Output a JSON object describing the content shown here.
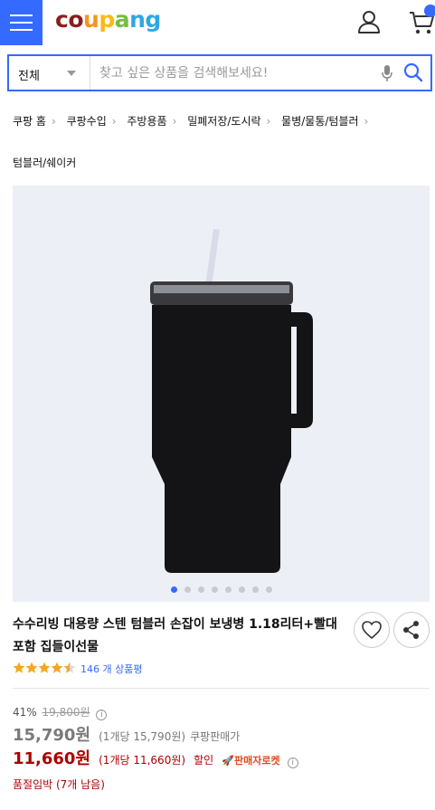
{
  "header": {
    "logo": [
      "c",
      "o",
      "u",
      "p",
      "a",
      "n",
      "g"
    ],
    "menu_icon": "hamburger-icon",
    "user_icon": "user-icon",
    "cart_icon": "cart-icon"
  },
  "search": {
    "category": "전체",
    "placeholder": "찾고 싶은 상품을 검색해보세요!"
  },
  "breadcrumb": {
    "items": [
      "쿠팡 홈",
      "쿠팡수입",
      "주방용품",
      "밀폐저장/도시락",
      "물병/물통/텀블러"
    ],
    "last": "텀블러/쉐이커"
  },
  "gallery": {
    "slide_count": 8,
    "active_index": 0
  },
  "product": {
    "title": "수수리빙 대용량 스텐 텀블러 손잡이 보냉병 1.18리터+빨대포함 집들이선물",
    "rating": 4.5,
    "review_count": "146 개 상품평"
  },
  "price": {
    "discount_rate": "41%",
    "original": "19,800원",
    "sale": "15,790원",
    "sale_unit": "(1개당 15,790원)",
    "seller": "쿠팡판매가",
    "rocket": "11,660원",
    "rocket_unit": "(1개당 11,660원)",
    "rocket_discount": "할인",
    "rocket_badge": "🚀판매자로켓",
    "stock": "품절임박 (7개 남음)"
  },
  "colors": {
    "accent": "#346aff",
    "price_red": "#ae0000",
    "image_bg": "#edeff7"
  }
}
